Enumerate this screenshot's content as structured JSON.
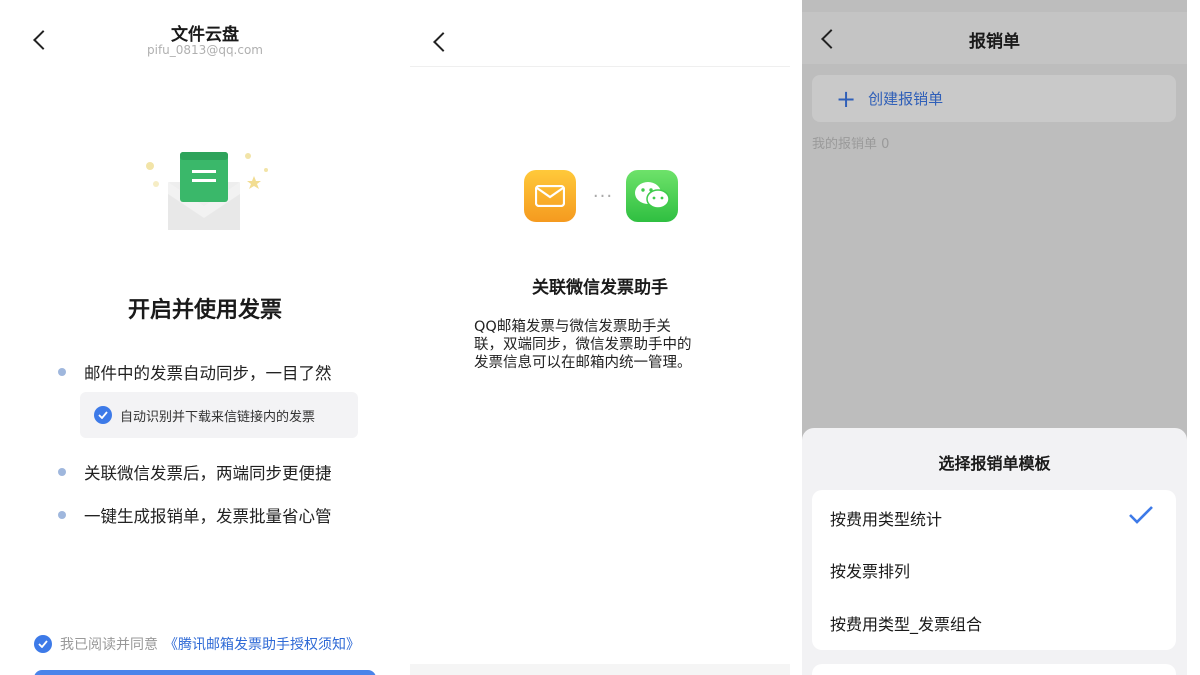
{
  "panel1": {
    "title": "文件云盘",
    "subtitle": "pifu_0813@qq.com",
    "heading": "开启并使用发票",
    "features": [
      "邮件中的发票自动同步，一目了然",
      "关联微信发票后，两端同步更便捷",
      "一键生成报销单，发票批量省心管"
    ],
    "sub_feature": "自动识别并下载来信链接内的发票",
    "agree_text": "我已阅读并同意",
    "agree_link": "《腾讯邮箱发票助手授权须知》"
  },
  "panel2": {
    "heading": "关联微信发票助手",
    "description_lines": [
      "QQ邮箱发票与微信发票助手关",
      "联，双端同步，微信发票助手中的",
      "发票信息可以在邮箱内统一管理。"
    ],
    "connector": "···"
  },
  "panel3": {
    "title": "报销单",
    "create_label": "创建报销单",
    "my_count_label": "我的报销单 0",
    "sheet_title": "选择报销单模板",
    "options": [
      {
        "label": "按费用类型统计",
        "selected": true
      },
      {
        "label": "按发票排列",
        "selected": false
      },
      {
        "label": "按费用类型_发票组合",
        "selected": false
      }
    ]
  },
  "colors": {
    "accent_blue": "#3d7ae8",
    "link_blue": "#2f6ad6",
    "envelope_green": "#3ab86a",
    "mail_orange": "#f59a1f",
    "wechat_green": "#2fbf41"
  }
}
